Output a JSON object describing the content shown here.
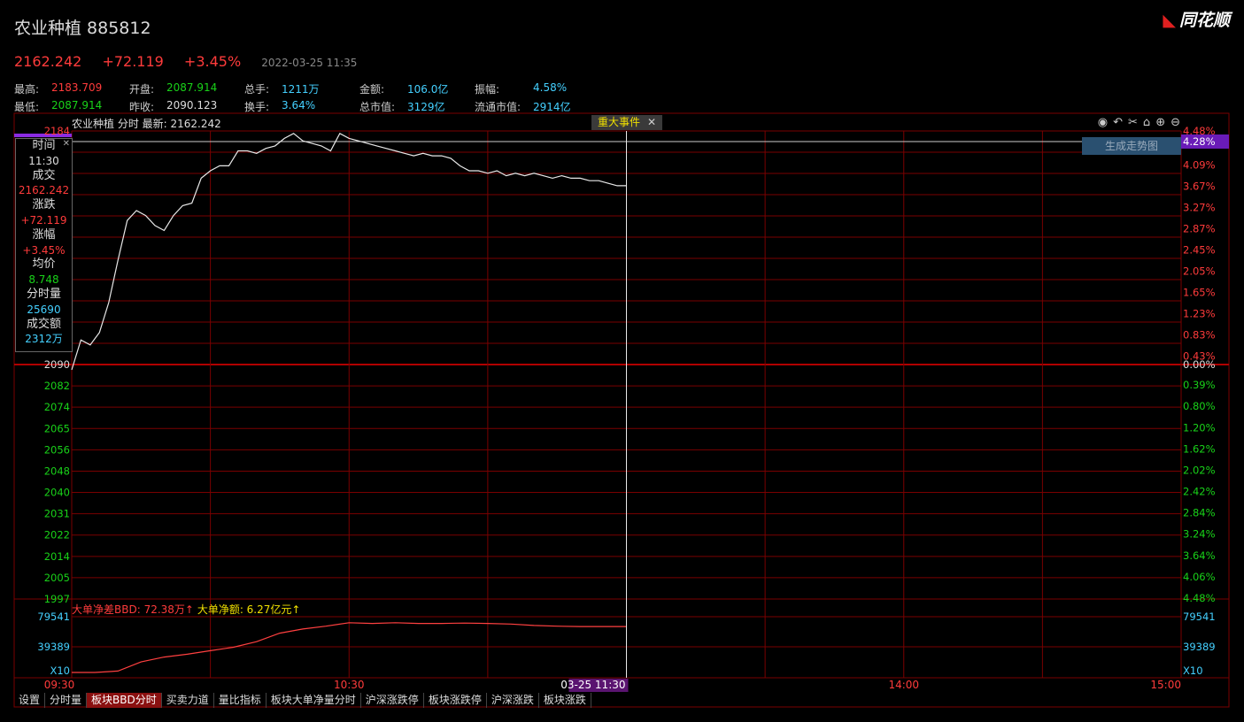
{
  "header": {
    "title": "农业种植 885812",
    "logo": "同花顺",
    "price": "2162.242",
    "change": "+72.119",
    "change_pct": "+3.45%",
    "datetime": "2022-03-25 11:35"
  },
  "stats": {
    "row1": [
      {
        "label": "最高:",
        "value": "2183.709",
        "color": "red"
      },
      {
        "label": "开盘:",
        "value": "2087.914",
        "color": "green"
      },
      {
        "label": "总手:",
        "value": "1211万",
        "color": "cyan"
      },
      {
        "label": "金额:",
        "value": "106.0亿",
        "color": "cyan"
      },
      {
        "label": "振幅:",
        "value": "4.58%",
        "color": "cyan"
      }
    ],
    "row2": [
      {
        "label": "最低:",
        "value": "2087.914",
        "color": "green"
      },
      {
        "label": "昨收:",
        "value": "2090.123",
        "color": "white"
      },
      {
        "label": "换手:",
        "value": "3.64%",
        "color": "cyan"
      },
      {
        "label": "总市值:",
        "value": "3129亿",
        "color": "cyan"
      },
      {
        "label": "流通市值:",
        "value": "2914亿",
        "color": "cyan"
      }
    ]
  },
  "chart_header": {
    "label": "农业种植 分时 最新: 2162.242",
    "event_tab": "重大事件",
    "event_close": "✕",
    "gen_trend_button": "生成走势图",
    "toolbar_icons": [
      "eye-icon",
      "undo-icon",
      "scissors-icon",
      "lock-icon",
      "zoom-in-icon",
      "zoom-out-icon"
    ]
  },
  "info_panel": {
    "close": "✕",
    "time_label": "时间",
    "time": "11:30",
    "deal_label": "成交",
    "deal": "2162.242",
    "chg_label": "涨跌",
    "chg": "+72.119",
    "pct_label": "涨幅",
    "pct": "+3.45%",
    "avg_label": "均价",
    "avg": "8.748",
    "vol_label": "分时量",
    "vol": "25690",
    "amt_label": "成交额",
    "amt": "2312万"
  },
  "bbd": {
    "label1": "大单净差BBD: 72.38万↑",
    "label2": "大单净额: 6.27亿元↑",
    "ticks_left": [
      "79541",
      "39389",
      "X10"
    ],
    "ticks_right": [
      "79541",
      "39389",
      "X10"
    ]
  },
  "bottom_tabs": [
    "设置",
    "分时量",
    "板块BBD分时",
    "买卖力道",
    "量比指标",
    "板块大单净量分时",
    "沪深涨跌停",
    "板块涨跌停",
    "沪深涨跌",
    "板块涨跌"
  ],
  "bottom_tabs_active": 2,
  "colors": {
    "up": "#ff3b3b",
    "down": "#19d219",
    "grid": "#7a0000",
    "accent": "#44d0ff"
  },
  "chart_data": {
    "type": "line",
    "x_ticks": [
      "09:30",
      "10:30",
      "03-25 11:30",
      "14:00",
      "15:00"
    ],
    "left_ticks": [
      "2184",
      "2090",
      "2082",
      "2074",
      "2065",
      "2056",
      "2048",
      "2040",
      "2031",
      "2022",
      "2014",
      "2005",
      "1997"
    ],
    "right_ticks_up": [
      "4.48%",
      "4.09%",
      "3.67%",
      "3.27%",
      "2.87%",
      "2.45%",
      "2.05%",
      "1.65%",
      "1.23%",
      "0.83%",
      "0.43%"
    ],
    "right_tick_zero": "0.00%",
    "right_ticks_down": [
      "0.39%",
      "0.80%",
      "1.20%",
      "1.62%",
      "2.02%",
      "2.42%",
      "2.84%",
      "3.24%",
      "3.64%",
      "4.06%",
      "4.48%"
    ],
    "highlight_pct": "4.28%",
    "ylim": [
      1997,
      2184
    ],
    "prev_close": 2090.123,
    "minutes_total": 240,
    "price_series": {
      "name": "分时",
      "x": [
        0,
        2,
        4,
        6,
        8,
        10,
        12,
        14,
        16,
        18,
        20,
        22,
        24,
        26,
        28,
        30,
        32,
        34,
        36,
        38,
        40,
        42,
        44,
        46,
        48,
        50,
        52,
        54,
        56,
        58,
        60,
        62,
        64,
        66,
        68,
        70,
        72,
        74,
        76,
        78,
        80,
        82,
        84,
        86,
        88,
        90,
        92,
        94,
        96,
        98,
        100,
        102,
        104,
        106,
        108,
        110,
        112,
        114,
        116,
        118,
        120
      ],
      "values": [
        2088,
        2100,
        2098,
        2103,
        2115,
        2132,
        2148,
        2152,
        2150,
        2146,
        2144,
        2150,
        2154,
        2155,
        2165,
        2168,
        2170,
        2170,
        2176,
        2176,
        2175,
        2177,
        2178,
        2181,
        2183,
        2180,
        2179,
        2178,
        2176,
        2183,
        2181,
        2180,
        2179,
        2178,
        2177,
        2176,
        2175,
        2174,
        2175,
        2174,
        2174,
        2173,
        2170,
        2168,
        2168,
        2167,
        2168,
        2166,
        2167,
        2166,
        2167,
        2166,
        2165,
        2166,
        2165,
        2165,
        2164,
        2164,
        2163,
        2162,
        2162
      ]
    },
    "bbd_series": {
      "x": [
        0,
        5,
        10,
        15,
        20,
        25,
        30,
        35,
        40,
        45,
        50,
        55,
        60,
        65,
        70,
        75,
        80,
        85,
        90,
        95,
        100,
        105,
        110,
        115,
        120
      ],
      "values": [
        0,
        0,
        2000,
        15000,
        22000,
        26000,
        31000,
        36000,
        44000,
        56000,
        62000,
        66000,
        71000,
        70000,
        71000,
        70000,
        70000,
        70500,
        70000,
        69000,
        67000,
        66000,
        65500,
        65500,
        65500
      ]
    },
    "bbd_ylim": [
      0,
      79541
    ]
  }
}
